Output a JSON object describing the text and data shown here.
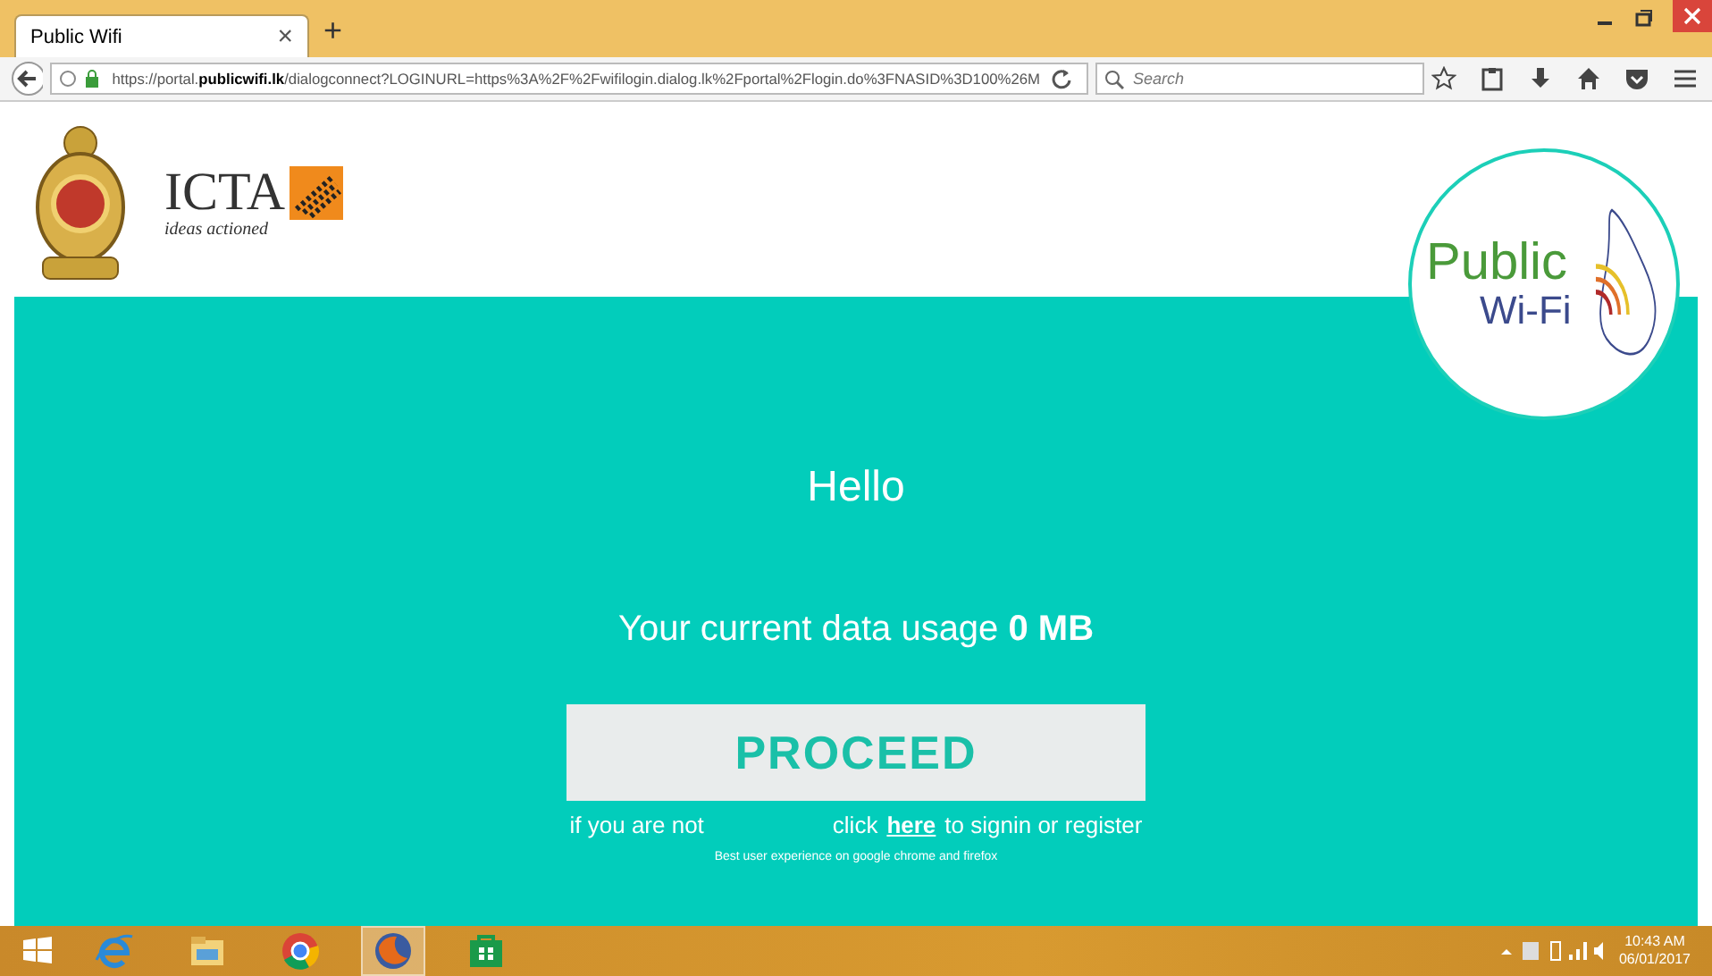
{
  "browser": {
    "tab": {
      "title": "Public Wifi",
      "close": "×",
      "selected": true
    },
    "new_tab": "+",
    "url": "https://portal.**publicwifi.lk**/dialogconnect?LOGINURL=https%3A%2F%2Fwifilogin.dialog.lk%2Fportal%2Flogin.do%3FNASID%3D100%26M",
    "search": {
      "placeholder": "Search"
    }
  },
  "header": {
    "icta_logo": {
      "name": "ICTA",
      "tagline": "ideas actioned"
    },
    "wifi_logo": {
      "line1": "Public",
      "line2": "Wi-Fi"
    }
  },
  "main": {
    "greeting": "Hello",
    "usage_text": "Your current data usage **0 MB**",
    "proceed_button": "PROCEED",
    "notice_before": "if you are not",
    "notice_click": "click",
    "notice_link": "here",
    "notice_after": "to signin or register",
    "footnote": "Best user experience on google chrome and firefox"
  },
  "taskbar": {
    "apps": [
      {
        "kind": "ie",
        "selected": false
      },
      {
        "kind": "explorer",
        "selected": false
      },
      {
        "kind": "chrome",
        "selected": false
      },
      {
        "kind": "firefox",
        "selected": true
      },
      {
        "kind": "store",
        "selected": false
      }
    ],
    "time": "10:43 AM",
    "date": "06/01/2017"
  }
}
